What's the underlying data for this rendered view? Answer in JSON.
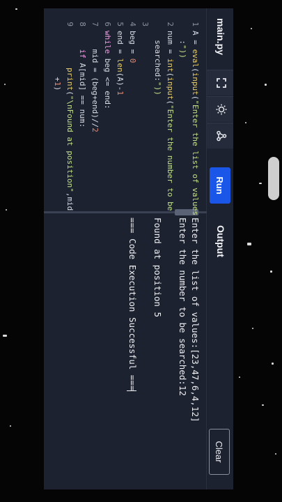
{
  "editor": {
    "file_tab": "main.py",
    "run_label": "Run",
    "icons": [
      "fullscreen-icon",
      "theme-brightness-icon",
      "share-icon"
    ]
  },
  "code_lines": [
    {
      "num": "1",
      "text": "A = eval(input(\"Enter the list of values"
    },
    {
      "num": "",
      "text": "  :\"))"
    },
    {
      "num": "2",
      "text": "num = int(input(\"Enter the number to be"
    },
    {
      "num": "",
      "text": "  searched:\"))"
    },
    {
      "num": "3",
      "text": ""
    },
    {
      "num": "4",
      "text": "beg = 0"
    },
    {
      "num": "5",
      "text": "end = len(A)-1"
    },
    {
      "num": "6",
      "text": "while beg <= end:"
    },
    {
      "num": "7",
      "text": "    mid = (beg+end)//2"
    },
    {
      "num": "8",
      "text": "    if A[mid] == num:"
    },
    {
      "num": "9",
      "text": "        print(\"\\nFound at position\",mid"
    },
    {
      "num": "",
      "text": "          +1)"
    }
  ],
  "output": {
    "title": "Output",
    "clear_label": "Clear",
    "lines": [
      "Enter the list of values:[23,47,6,4,12]",
      "Enter the number to be searched:12",
      "",
      "Found at position 5",
      "",
      "=== Code Execution Successful ==="
    ]
  }
}
